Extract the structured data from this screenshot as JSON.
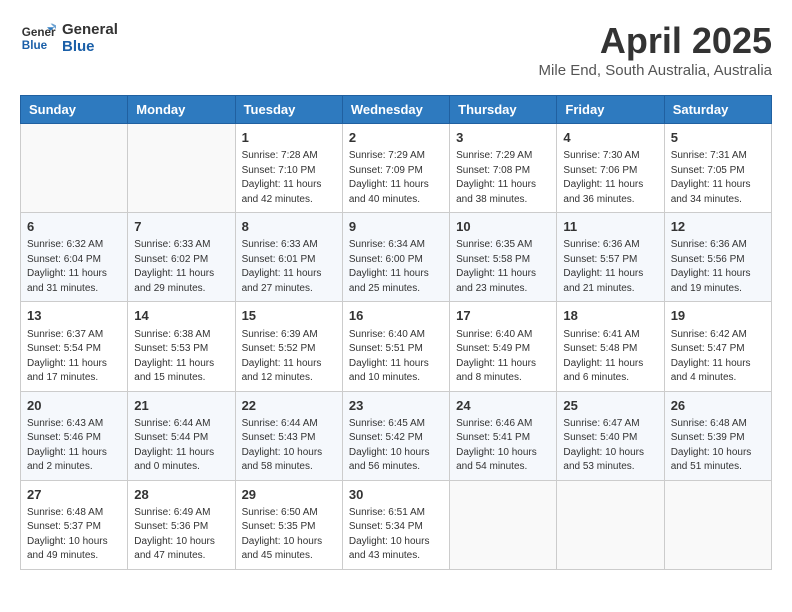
{
  "logo": {
    "line1": "General",
    "line2": "Blue"
  },
  "title": "April 2025",
  "subtitle": "Mile End, South Australia, Australia",
  "weekdays": [
    "Sunday",
    "Monday",
    "Tuesday",
    "Wednesday",
    "Thursday",
    "Friday",
    "Saturday"
  ],
  "weeks": [
    [
      {
        "day": "",
        "info": ""
      },
      {
        "day": "",
        "info": ""
      },
      {
        "day": "1",
        "info": "Sunrise: 7:28 AM\nSunset: 7:10 PM\nDaylight: 11 hours and 42 minutes."
      },
      {
        "day": "2",
        "info": "Sunrise: 7:29 AM\nSunset: 7:09 PM\nDaylight: 11 hours and 40 minutes."
      },
      {
        "day": "3",
        "info": "Sunrise: 7:29 AM\nSunset: 7:08 PM\nDaylight: 11 hours and 38 minutes."
      },
      {
        "day": "4",
        "info": "Sunrise: 7:30 AM\nSunset: 7:06 PM\nDaylight: 11 hours and 36 minutes."
      },
      {
        "day": "5",
        "info": "Sunrise: 7:31 AM\nSunset: 7:05 PM\nDaylight: 11 hours and 34 minutes."
      }
    ],
    [
      {
        "day": "6",
        "info": "Sunrise: 6:32 AM\nSunset: 6:04 PM\nDaylight: 11 hours and 31 minutes."
      },
      {
        "day": "7",
        "info": "Sunrise: 6:33 AM\nSunset: 6:02 PM\nDaylight: 11 hours and 29 minutes."
      },
      {
        "day": "8",
        "info": "Sunrise: 6:33 AM\nSunset: 6:01 PM\nDaylight: 11 hours and 27 minutes."
      },
      {
        "day": "9",
        "info": "Sunrise: 6:34 AM\nSunset: 6:00 PM\nDaylight: 11 hours and 25 minutes."
      },
      {
        "day": "10",
        "info": "Sunrise: 6:35 AM\nSunset: 5:58 PM\nDaylight: 11 hours and 23 minutes."
      },
      {
        "day": "11",
        "info": "Sunrise: 6:36 AM\nSunset: 5:57 PM\nDaylight: 11 hours and 21 minutes."
      },
      {
        "day": "12",
        "info": "Sunrise: 6:36 AM\nSunset: 5:56 PM\nDaylight: 11 hours and 19 minutes."
      }
    ],
    [
      {
        "day": "13",
        "info": "Sunrise: 6:37 AM\nSunset: 5:54 PM\nDaylight: 11 hours and 17 minutes."
      },
      {
        "day": "14",
        "info": "Sunrise: 6:38 AM\nSunset: 5:53 PM\nDaylight: 11 hours and 15 minutes."
      },
      {
        "day": "15",
        "info": "Sunrise: 6:39 AM\nSunset: 5:52 PM\nDaylight: 11 hours and 12 minutes."
      },
      {
        "day": "16",
        "info": "Sunrise: 6:40 AM\nSunset: 5:51 PM\nDaylight: 11 hours and 10 minutes."
      },
      {
        "day": "17",
        "info": "Sunrise: 6:40 AM\nSunset: 5:49 PM\nDaylight: 11 hours and 8 minutes."
      },
      {
        "day": "18",
        "info": "Sunrise: 6:41 AM\nSunset: 5:48 PM\nDaylight: 11 hours and 6 minutes."
      },
      {
        "day": "19",
        "info": "Sunrise: 6:42 AM\nSunset: 5:47 PM\nDaylight: 11 hours and 4 minutes."
      }
    ],
    [
      {
        "day": "20",
        "info": "Sunrise: 6:43 AM\nSunset: 5:46 PM\nDaylight: 11 hours and 2 minutes."
      },
      {
        "day": "21",
        "info": "Sunrise: 6:44 AM\nSunset: 5:44 PM\nDaylight: 11 hours and 0 minutes."
      },
      {
        "day": "22",
        "info": "Sunrise: 6:44 AM\nSunset: 5:43 PM\nDaylight: 10 hours and 58 minutes."
      },
      {
        "day": "23",
        "info": "Sunrise: 6:45 AM\nSunset: 5:42 PM\nDaylight: 10 hours and 56 minutes."
      },
      {
        "day": "24",
        "info": "Sunrise: 6:46 AM\nSunset: 5:41 PM\nDaylight: 10 hours and 54 minutes."
      },
      {
        "day": "25",
        "info": "Sunrise: 6:47 AM\nSunset: 5:40 PM\nDaylight: 10 hours and 53 minutes."
      },
      {
        "day": "26",
        "info": "Sunrise: 6:48 AM\nSunset: 5:39 PM\nDaylight: 10 hours and 51 minutes."
      }
    ],
    [
      {
        "day": "27",
        "info": "Sunrise: 6:48 AM\nSunset: 5:37 PM\nDaylight: 10 hours and 49 minutes."
      },
      {
        "day": "28",
        "info": "Sunrise: 6:49 AM\nSunset: 5:36 PM\nDaylight: 10 hours and 47 minutes."
      },
      {
        "day": "29",
        "info": "Sunrise: 6:50 AM\nSunset: 5:35 PM\nDaylight: 10 hours and 45 minutes."
      },
      {
        "day": "30",
        "info": "Sunrise: 6:51 AM\nSunset: 5:34 PM\nDaylight: 10 hours and 43 minutes."
      },
      {
        "day": "",
        "info": ""
      },
      {
        "day": "",
        "info": ""
      },
      {
        "day": "",
        "info": ""
      }
    ]
  ]
}
